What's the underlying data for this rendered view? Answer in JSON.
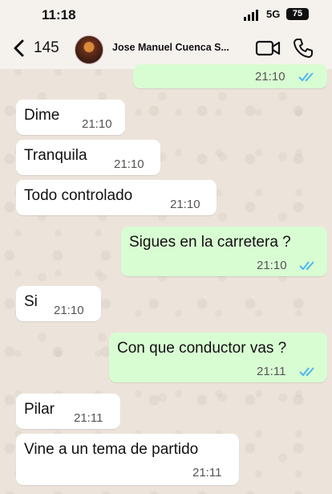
{
  "status_bar": {
    "time": "11:18",
    "network": "5G",
    "battery": "75"
  },
  "header": {
    "back_count": "145",
    "contact_name": "Jose Manuel Cuenca S..."
  },
  "colors": {
    "outgoing_bubble": "#d9fdd3",
    "incoming_bubble": "#ffffff",
    "read_ticks": "#4fb6ec"
  },
  "messages": [
    {
      "direction": "out",
      "text": "",
      "time": "21:10",
      "read": true
    },
    {
      "direction": "in",
      "text": "Dime",
      "time": "21:10"
    },
    {
      "direction": "in",
      "text": "Tranquila",
      "time": "21:10"
    },
    {
      "direction": "in",
      "text": "Todo controlado",
      "time": "21:10"
    },
    {
      "direction": "out",
      "text": "Sigues en la carretera ?",
      "time": "21:10",
      "read": true
    },
    {
      "direction": "in",
      "text": "Si",
      "time": "21:10"
    },
    {
      "direction": "out",
      "text": "Con que conductor vas ?",
      "time": "21:11",
      "read": true
    },
    {
      "direction": "in",
      "text": "Pilar",
      "time": "21:11"
    },
    {
      "direction": "in",
      "text": "Vine a un tema de partido",
      "time": "21:11"
    }
  ]
}
